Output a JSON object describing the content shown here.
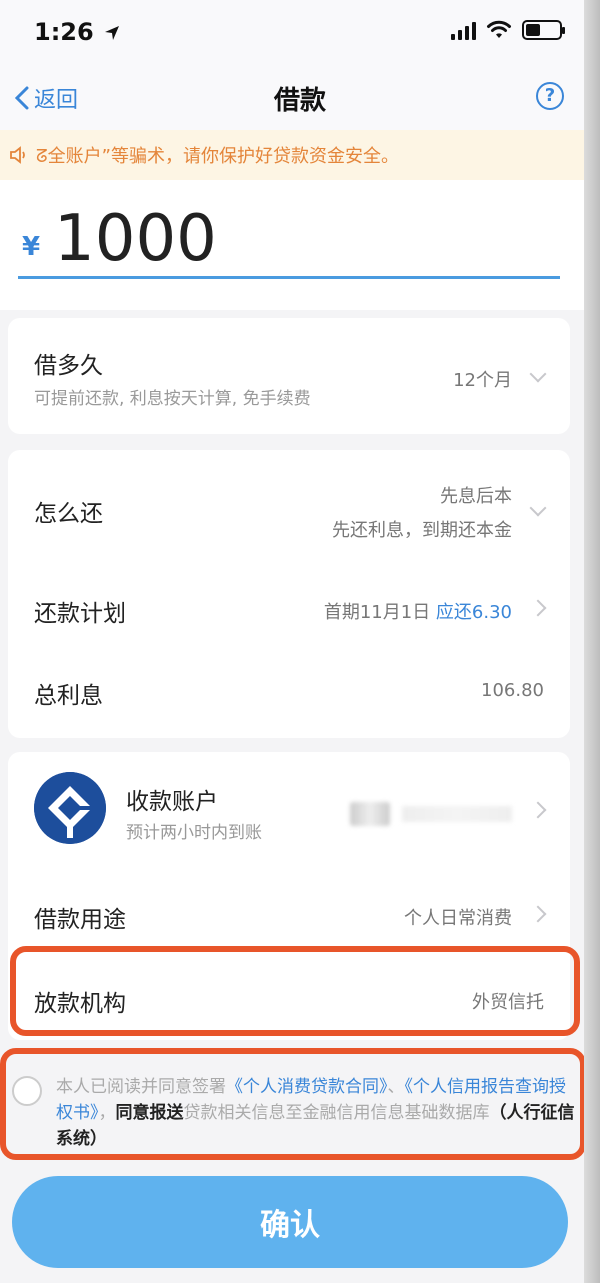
{
  "status_bar": {
    "time": "1:26"
  },
  "nav": {
    "back_label": "返回",
    "title": "借款",
    "help_label": "?"
  },
  "notice": {
    "text": "ᘔ全账户”等骗术，请你保护好贷款资金安全。"
  },
  "amount": {
    "currency": "¥",
    "value": "1000"
  },
  "term": {
    "label": "借多久",
    "sub": "可提前还款, 利息按天计算, 免手续费",
    "value": "12个月"
  },
  "repayment": {
    "method_label": "怎么还",
    "method_value_line1": "先息后本",
    "method_value_line2": "先还利息，到期还本金",
    "plan_label": "还款计划",
    "plan_value_prefix": "首期11月1日 ",
    "plan_value_highlight": "应还6.30",
    "interest_label": "总利息",
    "interest_value": "106.80"
  },
  "account": {
    "label": "收款账户",
    "sub": "预计两小时内到账",
    "purpose_label": "借款用途",
    "purpose_value": "个人日常消费",
    "lender_label": "放款机构",
    "lender_value": "外贸信托"
  },
  "agreement": {
    "prefix": "本人已阅读并同意签署",
    "link1": "《个人消费贷款合同》",
    "sep": "、",
    "link2": "《个人信用报告查询授权书》",
    "comma": "，",
    "bold1": "同意报送",
    "middle": "贷款相关信息至金融信用信息基础数据库",
    "bold2": "（人行征信系统）"
  },
  "confirm_label": "确认",
  "colors": {
    "accent": "#3a86d8",
    "button": "#5fb2ee",
    "highlight_border": "#e8552a",
    "notice_text": "#e4853a"
  }
}
